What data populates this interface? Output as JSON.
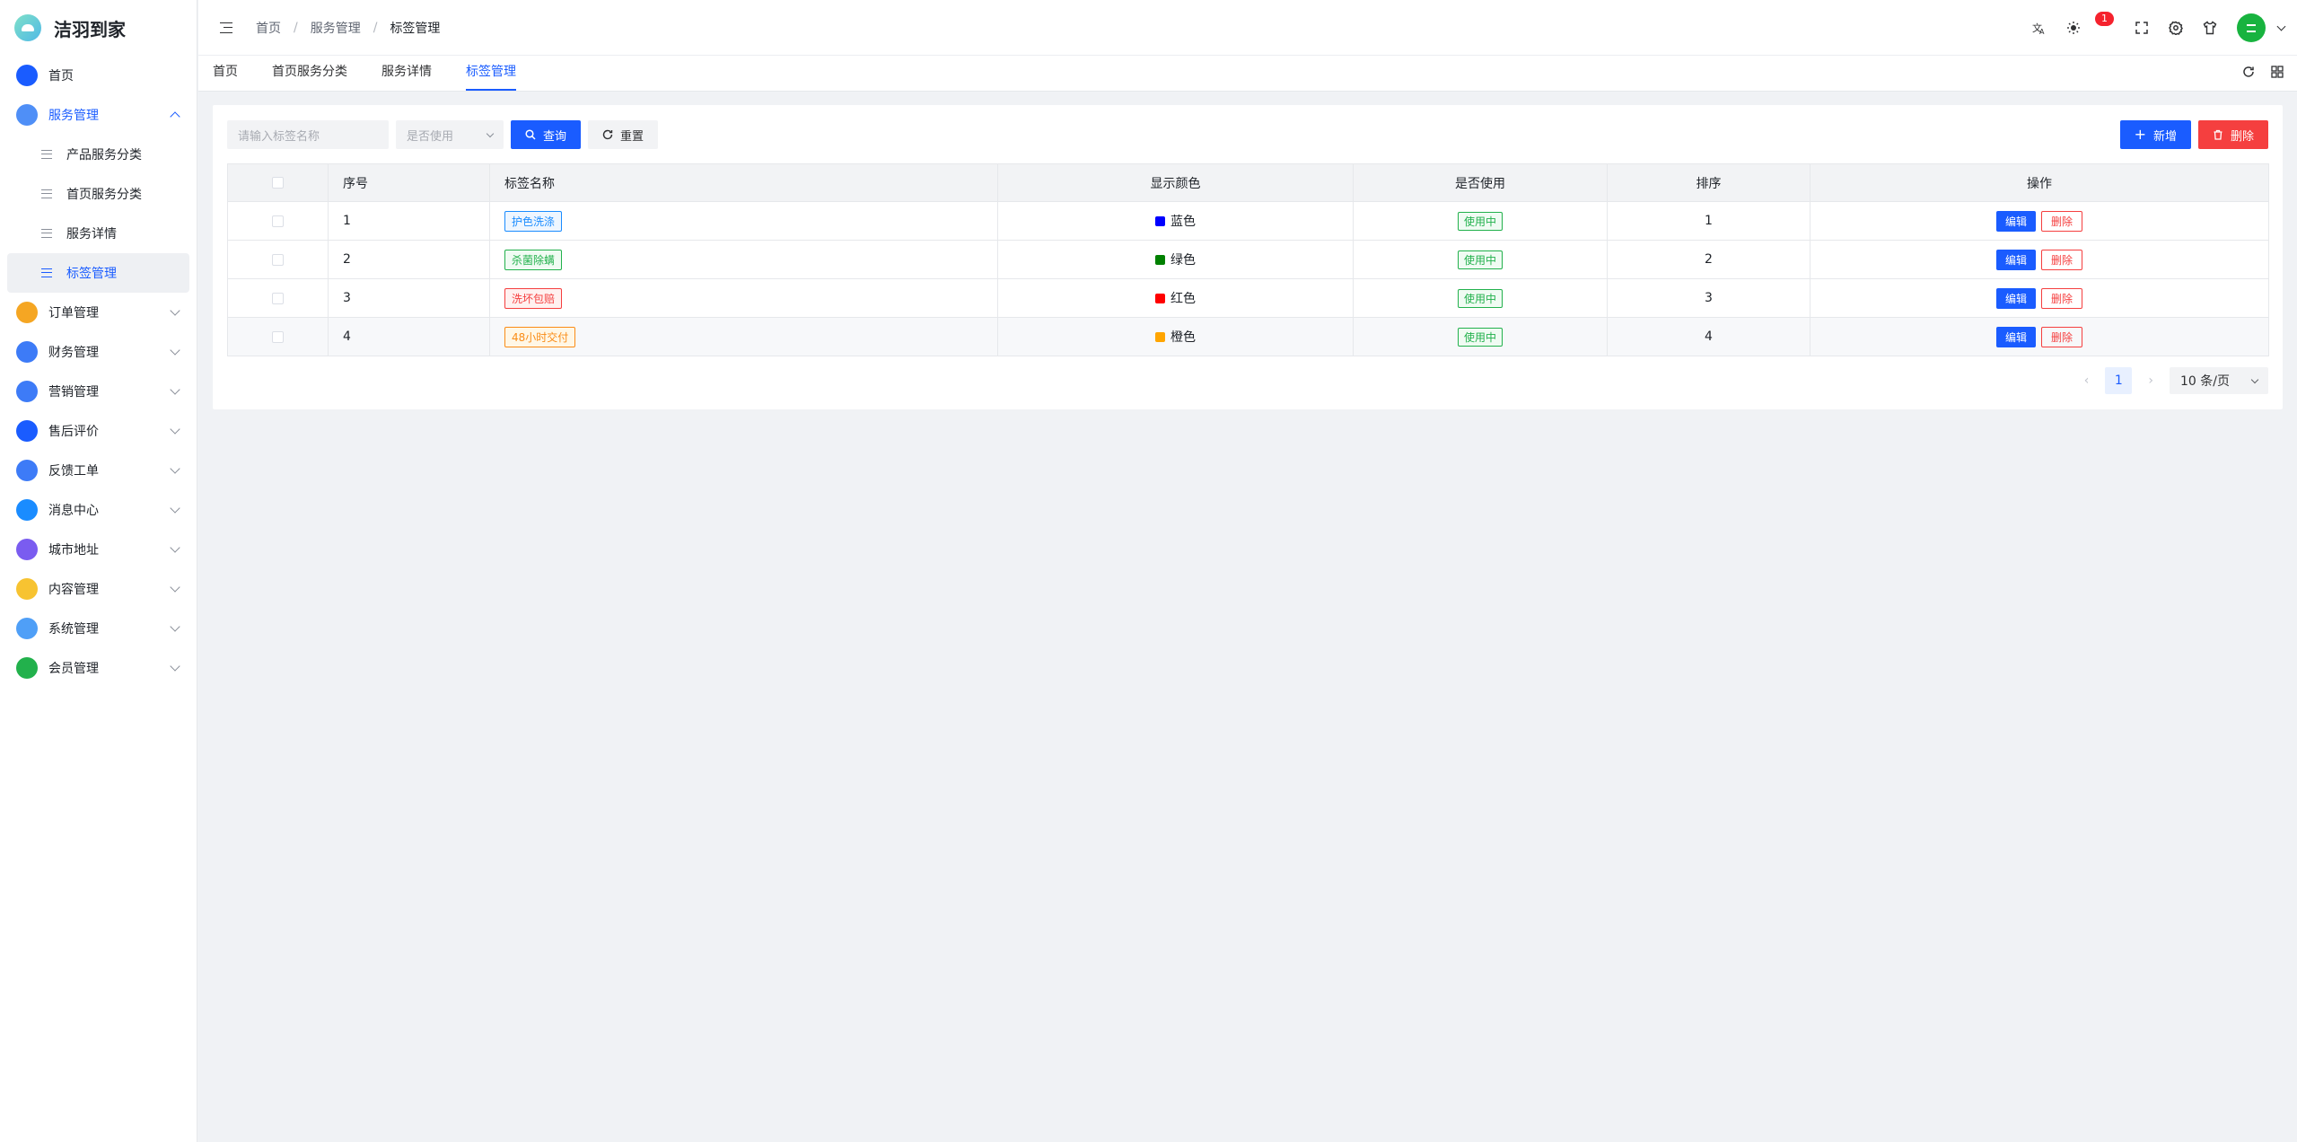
{
  "app": {
    "name": "洁羽到家"
  },
  "sidebar": {
    "items": [
      {
        "label": "首页",
        "icon": "home-icon",
        "color": "#1a5cff"
      },
      {
        "label": "服务管理",
        "icon": "clipboard-icon",
        "color": "#4f8ff7",
        "open": true,
        "children": [
          {
            "label": "产品服务分类"
          },
          {
            "label": "首页服务分类"
          },
          {
            "label": "服务详情"
          },
          {
            "label": "标签管理",
            "active": true
          }
        ]
      },
      {
        "label": "订单管理",
        "icon": "order-icon",
        "color": "#f5a623"
      },
      {
        "label": "财务管理",
        "icon": "finance-icon",
        "color": "#3d7bf7"
      },
      {
        "label": "营销管理",
        "icon": "marketing-icon",
        "color": "#3d7bf7"
      },
      {
        "label": "售后评价",
        "icon": "grid-icon",
        "color": "#1a5cff"
      },
      {
        "label": "反馈工单",
        "icon": "feedback-icon",
        "color": "#3d7bf7"
      },
      {
        "label": "消息中心",
        "icon": "link-icon",
        "color": "#1a8cff"
      },
      {
        "label": "城市地址",
        "icon": "planet-icon",
        "color": "#7a5cf0"
      },
      {
        "label": "内容管理",
        "icon": "folder-icon",
        "color": "#f7c331"
      },
      {
        "label": "系统管理",
        "icon": "tools-icon",
        "color": "#4f9ff7"
      },
      {
        "label": "会员管理",
        "icon": "user-icon",
        "color": "#22b14c"
      }
    ]
  },
  "header": {
    "breadcrumb": [
      "首页",
      "服务管理",
      "标签管理"
    ],
    "badge_count": "1"
  },
  "tabs": [
    {
      "label": "首页"
    },
    {
      "label": "首页服务分类"
    },
    {
      "label": "服务详情"
    },
    {
      "label": "标签管理",
      "active": true
    }
  ],
  "toolbar": {
    "search_placeholder": "请输入标签名称",
    "select_placeholder": "是否使用",
    "query_label": "查询",
    "reset_label": "重置",
    "add_label": "新增",
    "delete_label": "删除"
  },
  "table": {
    "headers": [
      "序号",
      "标签名称",
      "显示颜色",
      "是否使用",
      "排序",
      "操作"
    ],
    "rows": [
      {
        "index": "1",
        "name": "护色洗涤",
        "tag_color": "#1a8cff",
        "tag_bg": "#eef6ff",
        "color_name": "蓝色",
        "swatch": "#0000ff",
        "status": "使用中",
        "sort": "1"
      },
      {
        "index": "2",
        "name": "杀菌除螨",
        "tag_color": "#22b14c",
        "tag_bg": "#f0fbf3",
        "color_name": "绿色",
        "swatch": "#008000",
        "status": "使用中",
        "sort": "2"
      },
      {
        "index": "3",
        "name": "洗坏包赔",
        "tag_color": "#f53f3f",
        "tag_bg": "#fff1f0",
        "color_name": "红色",
        "swatch": "#ff0000",
        "status": "使用中",
        "sort": "3"
      },
      {
        "index": "4",
        "name": "48小时交付",
        "tag_color": "#fa8c16",
        "tag_bg": "#fff7e6",
        "color_name": "橙色",
        "swatch": "#ffa500",
        "status": "使用中",
        "sort": "4"
      }
    ],
    "edit_label": "编辑",
    "delete_label": "删除"
  },
  "pagination": {
    "current": "1",
    "page_size": "10 条/页"
  }
}
